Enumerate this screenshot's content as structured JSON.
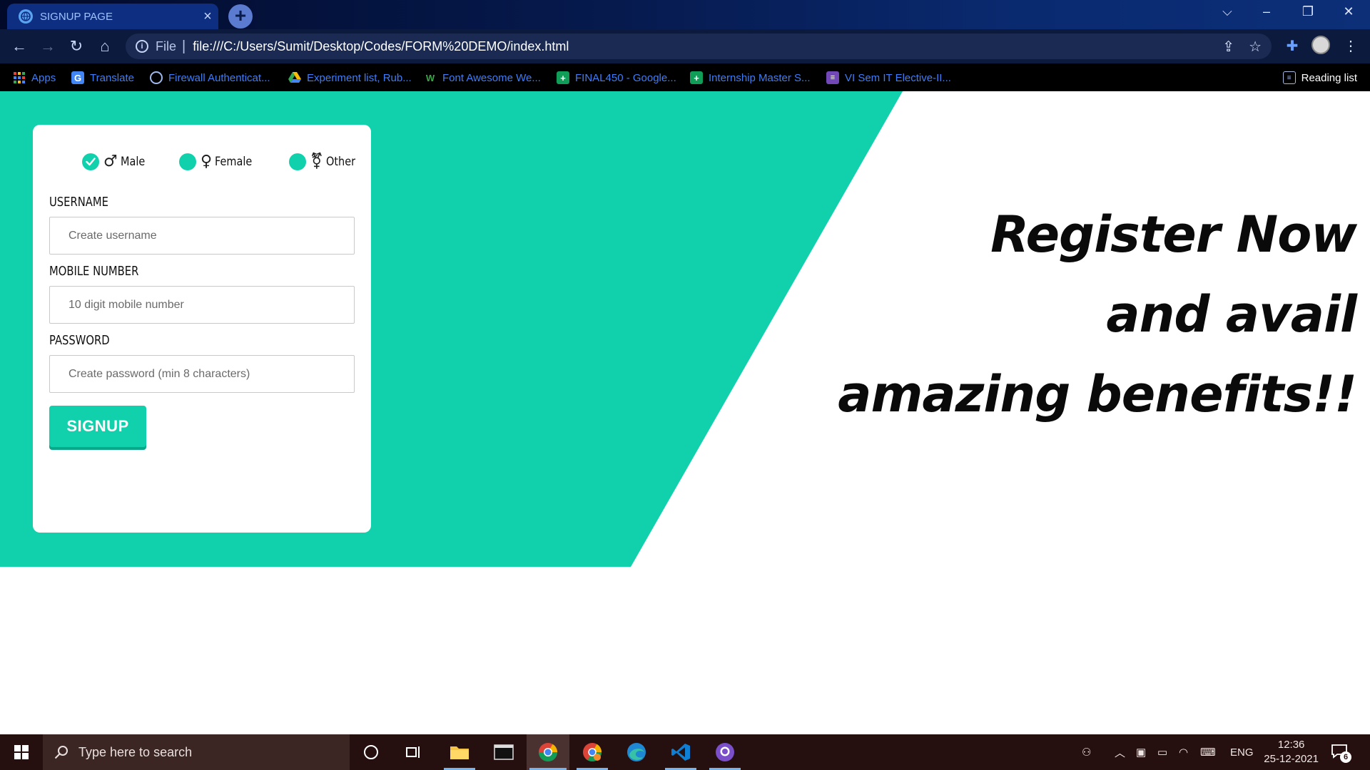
{
  "browser": {
    "tab_title": "SIGNUP PAGE",
    "url_scheme_label": "File",
    "url": "file:///C:/Users/Sumit/Desktop/Codes/FORM%20DEMO/index.html",
    "bookmarks": [
      {
        "label": "Apps",
        "icon": "apps-grid-icon"
      },
      {
        "label": "Translate",
        "icon": "translate-icon"
      },
      {
        "label": "Firewall Authenticat...",
        "icon": "globe-icon"
      },
      {
        "label": "Experiment list, Rub...",
        "icon": "drive-icon"
      },
      {
        "label": "Font Awesome We...",
        "icon": "font-awesome-icon"
      },
      {
        "label": "FINAL450 - Google...",
        "icon": "sheets-icon"
      },
      {
        "label": "Internship Master S...",
        "icon": "sheets-icon"
      },
      {
        "label": "VI Sem IT Elective-II...",
        "icon": "forms-icon"
      }
    ],
    "reading_list": "Reading list"
  },
  "form": {
    "genders": [
      {
        "label": "Male",
        "symbol": "♂",
        "checked": true
      },
      {
        "label": "Female",
        "symbol": "♀",
        "checked": false
      },
      {
        "label": "Other",
        "symbol": "⚧",
        "checked": false
      }
    ],
    "username_label": "USERNAME",
    "username_placeholder": "Create username",
    "mobile_label": "MOBILE NUMBER",
    "mobile_placeholder": "10 digit mobile number",
    "password_label": "PASSWORD",
    "password_placeholder": "Create password (min 8 characters)",
    "submit_label": "SIGNUP"
  },
  "promo": {
    "line1": "Register Now",
    "line2": "and avail",
    "line3": "amazing benefits!!"
  },
  "taskbar": {
    "search_placeholder": "Type here to search",
    "language": "ENG",
    "time": "12:36",
    "date": "25-12-2021",
    "notification_count": "6"
  },
  "colors": {
    "accent_teal": "#10d1ac",
    "tab_bar": "#0a2a70",
    "bookmark_link": "#3f7df5",
    "taskbar": "#26100f"
  }
}
